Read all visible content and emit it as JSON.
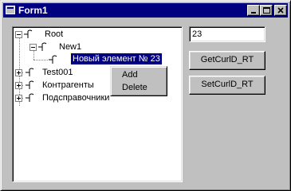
{
  "window": {
    "title": "Form1",
    "icon": "form-icon",
    "controls": [
      "minimize-icon",
      "maximize-icon",
      "close-icon"
    ]
  },
  "tree": {
    "nodes": [
      {
        "label": "Root",
        "expander": "minus",
        "icon": "node-icon"
      },
      {
        "label": "New1",
        "expander": "minus",
        "icon": "node-icon"
      },
      {
        "label": "Новый элемент № 23",
        "expander": "none",
        "icon": "node-icon",
        "selected": true
      },
      {
        "label": "Test001",
        "expander": "plus",
        "icon": "node-icon"
      },
      {
        "label": "Контрагенты",
        "expander": "plus",
        "icon": "node-icon"
      },
      {
        "label": "Подсправочники",
        "expander": "plus",
        "icon": "node-icon"
      }
    ]
  },
  "context_menu": {
    "items": [
      {
        "label": "Add"
      },
      {
        "label": "Delete"
      }
    ]
  },
  "textbox": {
    "value": "23"
  },
  "buttons": {
    "get_label": "GetCurlD_RT",
    "set_label": "SetCurlD_RT"
  }
}
